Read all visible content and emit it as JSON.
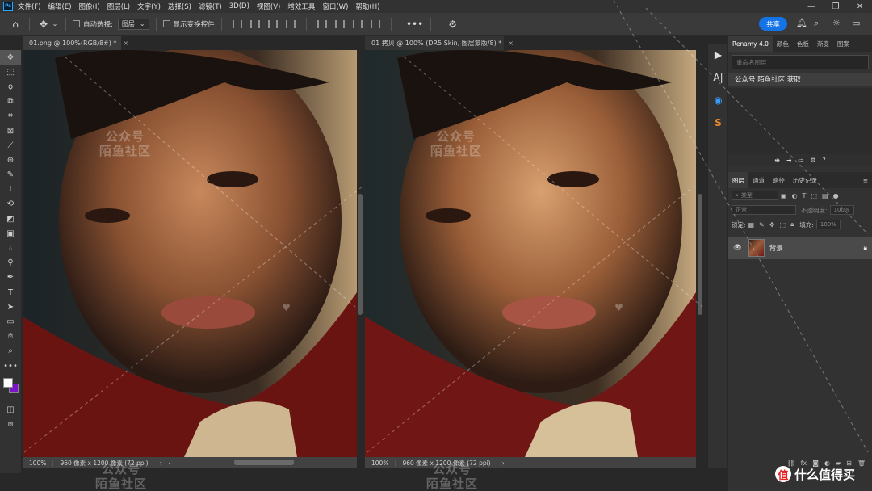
{
  "app": {
    "logo_text": "Ps"
  },
  "menu": [
    "文件(F)",
    "编辑(E)",
    "图像(I)",
    "图层(L)",
    "文字(Y)",
    "选择(S)",
    "滤镜(T)",
    "3D(D)",
    "视图(V)",
    "增效工具",
    "窗口(W)",
    "帮助(H)"
  ],
  "window_controls": {
    "minimize": "—",
    "restore": "❐",
    "close": "✕"
  },
  "options": {
    "auto_select_label": "自动选择:",
    "auto_select_value": "图层",
    "show_transform_label": "显示变换控件",
    "more": "•••",
    "share_label": "共享"
  },
  "tools": [
    "move",
    "marquee",
    "lasso",
    "object-select",
    "crop",
    "frame",
    "eyedropper",
    "healing",
    "brush",
    "stamp",
    "history-brush",
    "eraser",
    "gradient",
    "blur",
    "dodge",
    "pen",
    "type",
    "path-select",
    "shape",
    "hand",
    "zoom",
    "more"
  ],
  "colors": {
    "foreground": "#ffffff",
    "background": "#7a14c8",
    "accent": "#1473e6"
  },
  "documents": [
    {
      "tab": "01.png @ 100%(RGB/8#) *",
      "zoom": "100%",
      "dims": "960 像素 x 1200 像素 (72 ppi)"
    },
    {
      "tab": "01 拷贝 @ 100% (DR5 Skin, 图层蒙版/8) *",
      "zoom": "100%",
      "dims": "960 像素 x 1200 像素 (72 ppi)"
    }
  ],
  "watermark": {
    "line1": "公众号",
    "line2": "陌鱼社区"
  },
  "side_strip": [
    "▶",
    "A|",
    "◉",
    "S"
  ],
  "renamy": {
    "tabs": [
      "Renamy 4.0",
      "颜色",
      "色板",
      "渐变",
      "图案"
    ],
    "placeholder": "重命名图层",
    "item": "公众号 陌鱼社区 获取"
  },
  "layers": {
    "tabs": [
      "图层",
      "通道",
      "路径",
      "历史记录"
    ],
    "filter_label": "类型",
    "blend_mode": "正常",
    "opacity_label": "不透明度:",
    "opacity_value": "100%",
    "lock_label": "锁定:",
    "fill_label": "填充:",
    "fill_value": "100%",
    "layer_name": "背景"
  },
  "brand": {
    "logo": "值",
    "text": "什么值得买"
  }
}
